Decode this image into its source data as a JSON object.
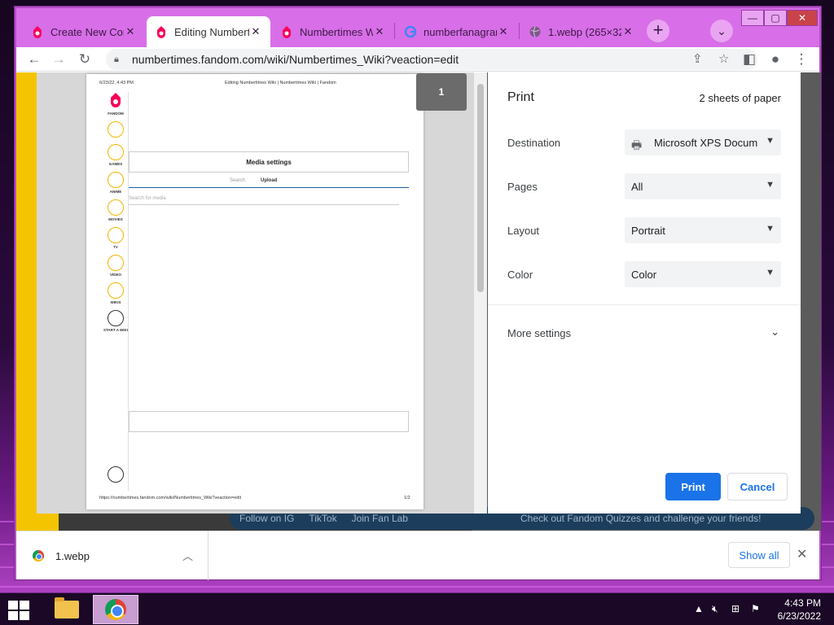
{
  "tabs": [
    {
      "title": "Create New Cor",
      "icon": "fandom-icon",
      "active": false
    },
    {
      "title": "Editing Numbert",
      "icon": "fandom-icon",
      "active": true
    },
    {
      "title": "Numbertimes W",
      "icon": "fandom-icon",
      "active": false
    },
    {
      "title": "numberfanagran",
      "icon": "google-icon",
      "active": false
    },
    {
      "title": "1.webp (265×32",
      "icon": "globe-icon",
      "active": false
    }
  ],
  "toolbar": {
    "url": "numbertimes.fandom.com/wiki/Numbertimes_Wiki?veaction=edit"
  },
  "preview": {
    "header_date": "6/23/22, 4:43 PM",
    "header_title": "Editing Numbertimes Wiki | Numbertimes Wiki | Fandom",
    "logo_label": "FANDOM",
    "rail_labels": [
      "GAMES",
      "ANIME",
      "MOVIES",
      "TV",
      "VIDEO",
      "WIKIS",
      "START A WIKI"
    ],
    "media_settings": "Media settings",
    "tab_search": "Search",
    "tab_upload": "Upload",
    "search_placeholder": "Search for media",
    "footer_url": "https://numbertimes.fandom.com/wiki/Numbertimes_Wiki?veaction=edit",
    "footer_page": "1/2",
    "page_number": "1"
  },
  "print": {
    "title": "Print",
    "sheets": "2 sheets of paper",
    "destination_label": "Destination",
    "destination_value": "Microsoft XPS Docum",
    "pages_label": "Pages",
    "pages_value": "All",
    "layout_label": "Layout",
    "layout_value": "Portrait",
    "color_label": "Color",
    "color_value": "Color",
    "more_settings": "More settings",
    "print_button": "Print",
    "cancel_button": "Cancel"
  },
  "background_page": {
    "banner_items": [
      "Follow on IG",
      "TikTok",
      "Join Fan Lab",
      "Check out Fandom Quizzes and challenge your friends!"
    ]
  },
  "downloads": {
    "file": "1.webp",
    "show_all": "Show all"
  },
  "taskbar": {
    "time": "4:43 PM",
    "date": "6/23/2022"
  },
  "colors": {
    "accent": "#1a73e8",
    "titlebar": "#d86ee8",
    "fandom_yellow": "#f5c400"
  }
}
